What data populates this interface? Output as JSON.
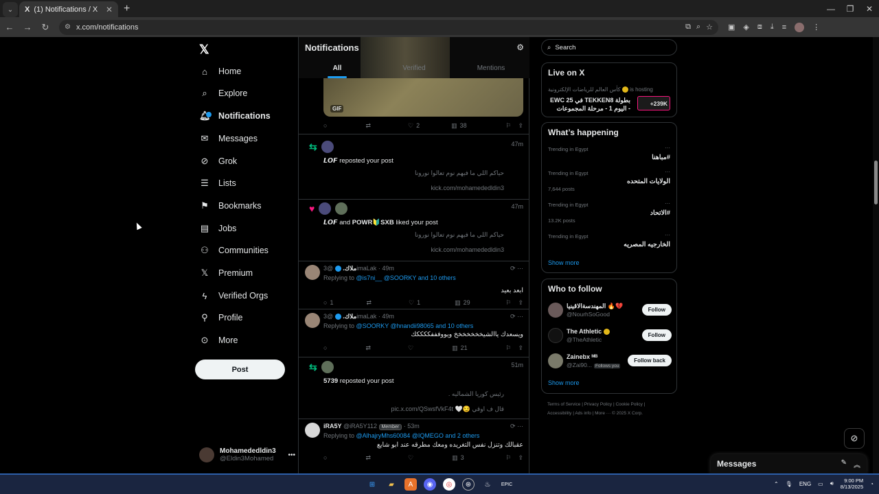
{
  "browser": {
    "tab_title": "(1) Notifications / X",
    "tab_favicon": "X",
    "url": "x.com/notifications"
  },
  "nav": {
    "items": [
      {
        "label": "Home",
        "icon": "home-icon"
      },
      {
        "label": "Explore",
        "icon": "search-icon"
      },
      {
        "label": "Notifications",
        "icon": "bell-icon"
      },
      {
        "label": "Messages",
        "icon": "envelope-icon"
      },
      {
        "label": "Grok",
        "icon": "grok-icon"
      },
      {
        "label": "Lists",
        "icon": "list-icon"
      },
      {
        "label": "Bookmarks",
        "icon": "bookmark-icon"
      },
      {
        "label": "Jobs",
        "icon": "briefcase-icon"
      },
      {
        "label": "Communities",
        "icon": "people-icon"
      },
      {
        "label": "Premium",
        "icon": "x-logo-icon"
      },
      {
        "label": "Verified Orgs",
        "icon": "lightning-icon"
      },
      {
        "label": "Profile",
        "icon": "person-icon"
      },
      {
        "label": "More",
        "icon": "more-circle-icon"
      }
    ],
    "post_label": "Post",
    "account_name": "Mohamededldin3",
    "account_handle": "@Eldin3Mohamed"
  },
  "notifications": {
    "title": "Notifications",
    "tabs": [
      "All",
      "Verified",
      "Mentions"
    ],
    "gif_label": "GIF",
    "top_actions": {
      "likes": "2",
      "views": "38"
    },
    "items": [
      {
        "type": "repost",
        "time": "47m",
        "actors": "𝙇𝙊𝙁",
        "action": "reposted your post",
        "quote1": "حياكم اللي ما فيهم نوم تعالوا نورونا",
        "quote2": "kick.com/mohamededldin3"
      },
      {
        "type": "like",
        "time": "47m",
        "actor1": "𝙇𝙊𝙁",
        "and": "and",
        "actor2": "POWR🔰SXB",
        "action": "liked your post",
        "quote1": "حياكم اللي ما فيهم نوم تعالوا نورونا",
        "quote2": "kick.com/mohamededldin3"
      },
      {
        "type": "repost",
        "time": "51m",
        "actors": "5739",
        "action": "reposted your post",
        "quote1": "رئيس كوريا الشماليه .",
        "quote2": "pic.x.com/QSwsfVkF4t 🤍😏 قال ف اوقي"
      }
    ],
    "tweets": [
      {
        "name": "ملاك.",
        "handle": "@3imaLak",
        "time": "49m",
        "replying": "Replying to",
        "mentions": "@is7ni__ @SOORKY and 10 others",
        "text": "ابعد بعيد",
        "replies": "1",
        "likes": "1",
        "views": "29"
      },
      {
        "name": "ملاك.",
        "handle": "@3imaLak",
        "time": "49m",
        "replying": "Replying to",
        "mentions": "@SOORKY @hnandii98065 and 10 others",
        "text": "ويسعدك ياالشيخخخخخخخ ويووفففككككك",
        "replies": "",
        "likes": "",
        "views": "21"
      },
      {
        "name": "iRA5Y",
        "handle": "@iRA5Y112",
        "badge": "Member",
        "time": "53m",
        "replying": "Replying to",
        "mentions": "@AlhajryMhs60084 @IQMEGO and 2 others",
        "text": "عقبالك وتنزل نفس التغريده ومعك مطرقه عند ابو شايع",
        "replies": "",
        "likes": "",
        "views": "3"
      }
    ]
  },
  "sidebar": {
    "search_placeholder": "Search",
    "live": {
      "title": "Live on X",
      "host": "كأس العالم للرياضات الإلكترونية",
      "hosting": "is hosting",
      "stream_title": "بطولة TEKKEN8 في EWC 25 - اليوم 1 - مرحلة المجموعات",
      "viewers": "+239K"
    },
    "happening": {
      "title": "What’s happening",
      "trends": [
        {
          "context": "Trending in Egypt",
          "name": "#مباهنا",
          "posts": ""
        },
        {
          "context": "Trending in Egypt",
          "name": "الولايات المتحده",
          "posts": "7,644 posts"
        },
        {
          "context": "Trending in Egypt",
          "name": "#الاتحاد",
          "posts": "13.2K posts"
        },
        {
          "context": "Trending in Egypt",
          "name": "الخارجيه المصريه",
          "posts": ""
        }
      ],
      "show_more": "Show more"
    },
    "who_to_follow": {
      "title": "Who to follow",
      "users": [
        {
          "name": "المهندسةالاقينيا 🔥💔",
          "handle": "@NourhSoGood",
          "button": "Follow",
          "follows_you": ""
        },
        {
          "name": "The Athletic",
          "handle": "@TheAthletic",
          "button": "Follow",
          "follows_you": ""
        },
        {
          "name": "Zainebx ᴹᴮ",
          "handle": "@Zai90...",
          "button": "Follow back",
          "follows_you": "Follows you"
        }
      ],
      "show_more": "Show more"
    },
    "footer_line1": "Terms of Service  |  Privacy Policy  |  Cookie Policy  |",
    "footer_line2": "Accessibility  |  Ads info  |  More ···  © 2025 X Corp."
  },
  "messages_dock": {
    "label": "Messages"
  },
  "taskbar": {
    "lang": "ENG",
    "time": "9:00 PM",
    "date": "8/13/2025"
  }
}
